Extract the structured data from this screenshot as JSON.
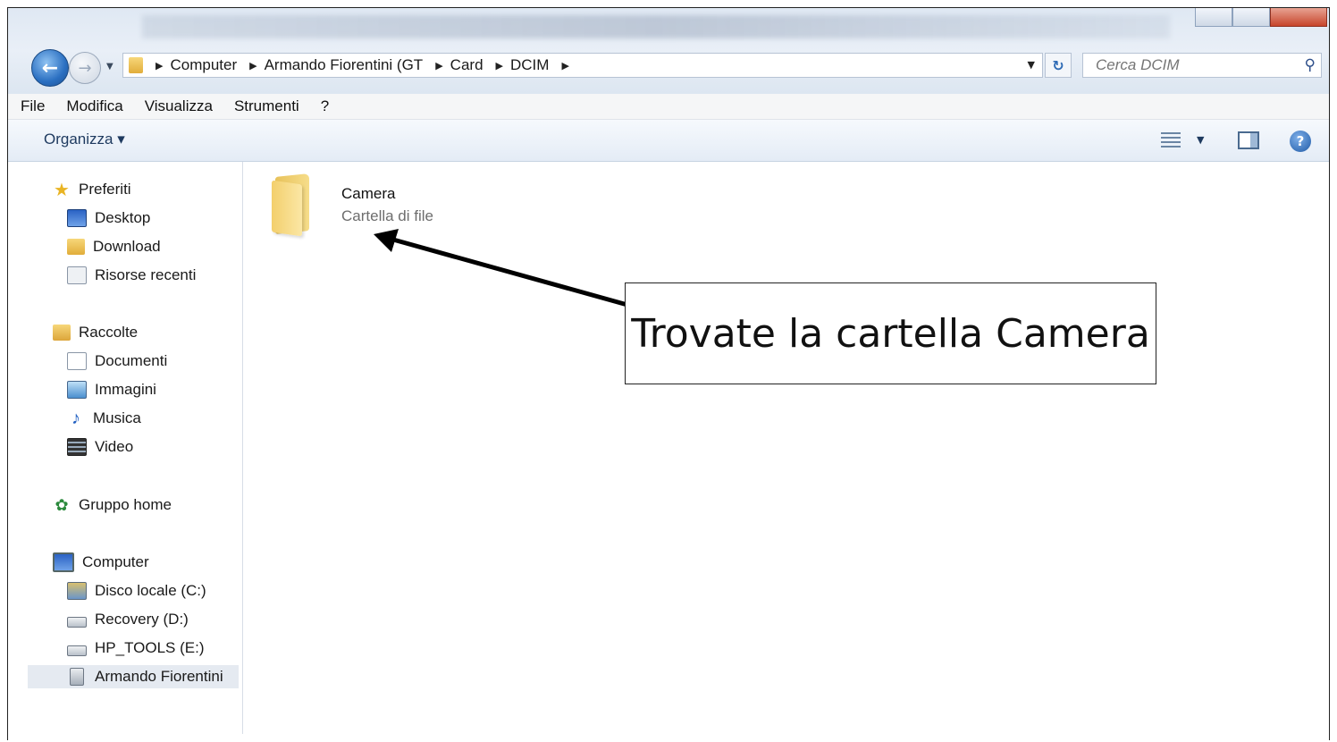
{
  "address_bar": {
    "crumbs": [
      "Computer",
      "Armando Fiorentini (GT",
      "Card",
      "DCIM"
    ]
  },
  "search": {
    "placeholder": "Cerca DCIM"
  },
  "menu": [
    "File",
    "Modifica",
    "Visualizza",
    "Strumenti",
    "?"
  ],
  "command_bar": {
    "organize_label": "Organizza ▾"
  },
  "sidebar": {
    "favorites": {
      "label": "Preferiti",
      "items": [
        "Desktop",
        "Download",
        "Risorse recenti"
      ]
    },
    "libraries": {
      "label": "Raccolte",
      "items": [
        "Documenti",
        "Immagini",
        "Musica",
        "Video"
      ]
    },
    "homegroup": {
      "label": "Gruppo home"
    },
    "computer": {
      "label": "Computer",
      "items": [
        "Disco locale (C:)",
        "Recovery (D:)",
        "HP_TOOLS (E:)",
        "Armando Fiorentini"
      ]
    }
  },
  "content": {
    "items": [
      {
        "name": "Camera",
        "type": "Cartella di file"
      }
    ]
  },
  "annotation": {
    "text": "Trovate la cartella Camera"
  }
}
